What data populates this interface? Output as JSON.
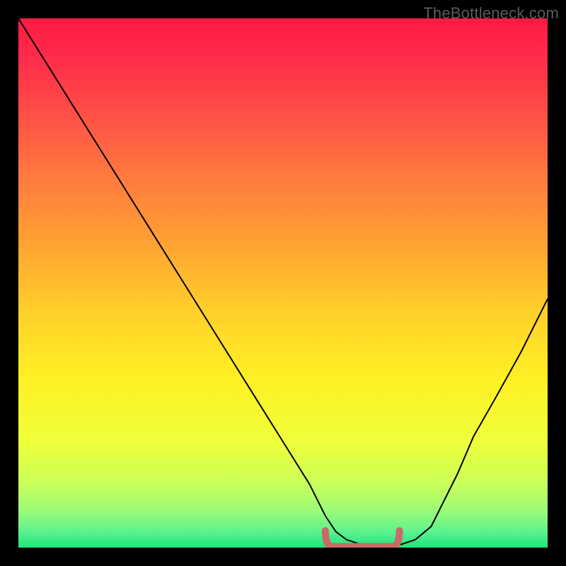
{
  "watermark": "TheBottleneck.com",
  "chart_data": {
    "type": "line",
    "title": "",
    "xlabel": "",
    "ylabel": "",
    "xlim": [
      0,
      100
    ],
    "ylim": [
      0,
      100
    ],
    "categories": [],
    "series": [
      {
        "name": "curve",
        "x": [
          0,
          5,
          10,
          15,
          20,
          25,
          30,
          35,
          40,
          45,
          50,
          55,
          58,
          60,
          62,
          65,
          68,
          70,
          72,
          75,
          78,
          80,
          83,
          86,
          90,
          95,
          100
        ],
        "values": [
          100,
          92,
          84,
          76,
          68,
          60,
          52,
          44,
          36,
          28,
          20,
          12,
          6,
          3,
          1.5,
          0.5,
          0,
          0,
          0.5,
          1.5,
          4,
          8,
          14,
          21,
          28,
          37,
          47
        ]
      }
    ],
    "trough_marker": {
      "x_start": 58,
      "x_end": 72,
      "y": 2,
      "color": "#c96a66"
    },
    "gradient_stops": [
      {
        "offset": 0.0,
        "color": "#ff1a44"
      },
      {
        "offset": 0.08,
        "color": "#ff2d4a"
      },
      {
        "offset": 0.18,
        "color": "#ff4f47"
      },
      {
        "offset": 0.3,
        "color": "#ff7a3e"
      },
      {
        "offset": 0.42,
        "color": "#ffa033"
      },
      {
        "offset": 0.55,
        "color": "#ffcf2a"
      },
      {
        "offset": 0.68,
        "color": "#fff024"
      },
      {
        "offset": 0.8,
        "color": "#efff3a"
      },
      {
        "offset": 0.88,
        "color": "#c9ff5a"
      },
      {
        "offset": 0.93,
        "color": "#9cfb78"
      },
      {
        "offset": 0.97,
        "color": "#5df28f"
      },
      {
        "offset": 1.0,
        "color": "#1be57c"
      }
    ],
    "curve_color": "#000000",
    "curve_width": 2
  }
}
